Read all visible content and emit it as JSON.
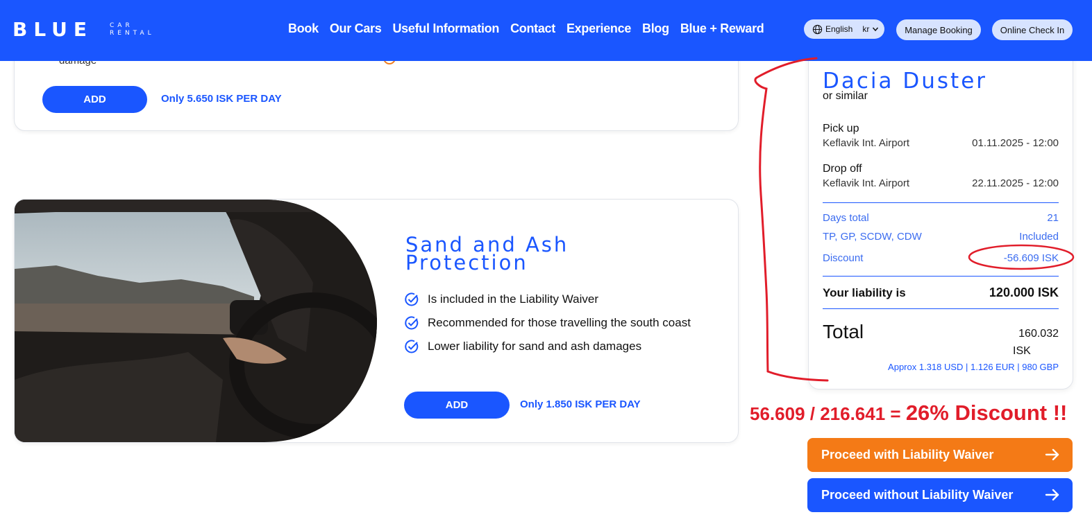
{
  "header": {
    "logo_main": "BLUE",
    "logo_sub": "CAR RENTAL",
    "nav": [
      "Book",
      "Our Cars",
      "Useful Information",
      "Contact",
      "Experience",
      "Blog",
      "Blue + Reward"
    ],
    "language": "English",
    "currency": "kr",
    "manage_booking": "Manage Booking",
    "online_check_in": "Online Check In"
  },
  "top_card": {
    "partial_text": "damage",
    "add_label": "ADD",
    "price_note": "Only 5.650 ISK PER DAY"
  },
  "sand_card": {
    "title_line1": "Sand and Ash",
    "title_line2": "Protection",
    "features": [
      "Is included in the Liability Waiver",
      "Recommended for those travelling the south coast",
      "Lower liability for sand and ash damages"
    ],
    "add_label": "ADD",
    "price_note": "Only 1.850 ISK PER DAY"
  },
  "summary": {
    "car": "Dacia Duster",
    "or_similar": "or similar",
    "pickup_label": "Pick up",
    "pickup_location": "Keflavik Int. Airport",
    "pickup_date": "01.11.2025 - 12:00",
    "dropoff_label": "Drop off",
    "dropoff_location": "Keflavik Int. Airport",
    "dropoff_date": "22.11.2025 - 12:00",
    "days_label": "Days total",
    "days_value": "21",
    "coverage_label": "TP, GP, SCDW, CDW",
    "coverage_value": "Included",
    "discount_label": "Discount",
    "discount_value": "-56.609 ISK",
    "liability_label": "Your liability is",
    "liability_value": "120.000 ISK",
    "total_label": "Total",
    "total_amount": "160.032",
    "total_currency": "ISK",
    "approx": "Approx 1.318 USD | 1.126 EUR | 980 GBP"
  },
  "annotation": {
    "calc": "56.609 / 216.641 = ",
    "emphasis": "26% Discount !!",
    "color": "#e11d2a"
  },
  "proceed": {
    "with_waiver": "Proceed with Liability Waiver",
    "without_waiver": "Proceed without Liability Waiver"
  },
  "colors": {
    "brand_blue": "#1a56ff",
    "orange": "#f47a16"
  }
}
